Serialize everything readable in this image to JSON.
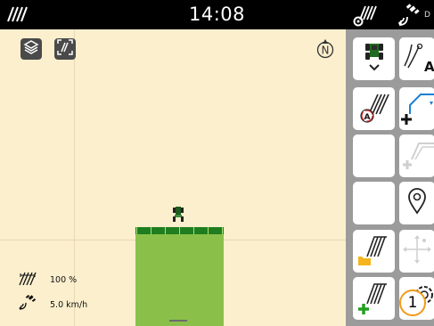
{
  "status_bar": {
    "time": "14:08",
    "right_text": "D",
    "icons": [
      "implement-icon",
      "field-tractor-icon",
      "gps-satellite-icon"
    ]
  },
  "map": {
    "layers_icon": "layers-icon",
    "view_icon": "field-view-icon",
    "compass_label": "N",
    "stats": {
      "working_width": "100 %",
      "speed": "5.0 km/h"
    }
  },
  "side_panel": {
    "buttons": [
      {
        "name": "tractor-implement",
        "icon": "tractor-dropdown-icon"
      },
      {
        "name": "tramline-auto",
        "icon": "tramline-auto-icon"
      },
      {
        "name": "guidance-auto",
        "icon": "guidance-a-icon"
      },
      {
        "name": "add-field-boundary",
        "icon": "add-boundary-icon"
      },
      {
        "name": "empty-slot",
        "icon": ""
      },
      {
        "name": "add-obstacle",
        "icon": "add-obstacle-icon"
      },
      {
        "name": "empty-slot",
        "icon": ""
      },
      {
        "name": "location-marker",
        "icon": "location-pin-icon"
      },
      {
        "name": "open-field",
        "icon": "folder-field-icon"
      },
      {
        "name": "move-points",
        "icon": "move-icon"
      },
      {
        "name": "new-field",
        "icon": "add-field-icon"
      },
      {
        "name": "settings",
        "icon": "gear-icon"
      }
    ]
  },
  "callout": {
    "label": "1"
  },
  "colors": {
    "map_background": "#fbefcd",
    "field_green": "#8ac04a",
    "boom_green": "#1f7d1f",
    "panel_gray": "#9b9b9b",
    "accent_orange": "#f29a1a",
    "accent_blue": "#1a7fd4"
  }
}
